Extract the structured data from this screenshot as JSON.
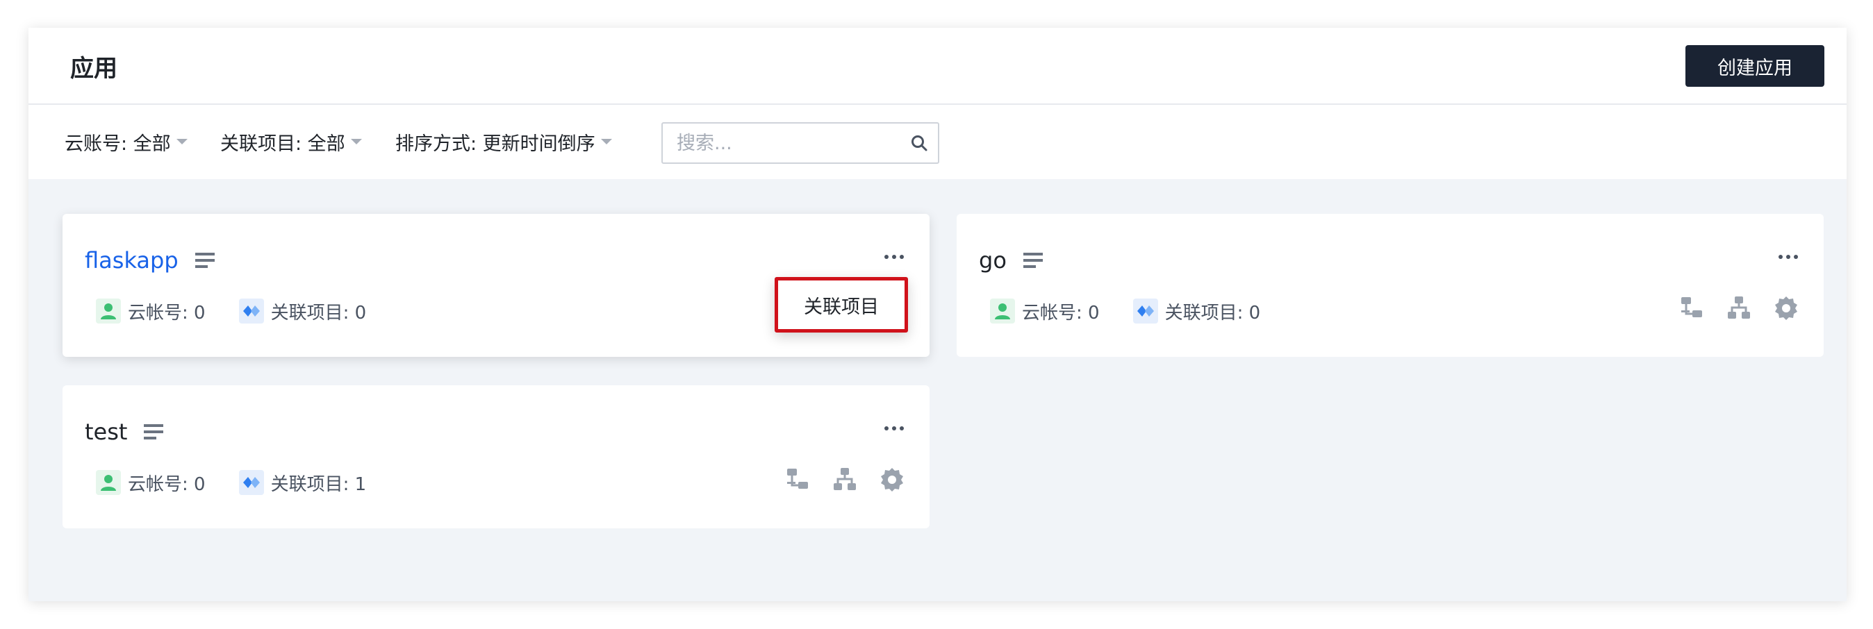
{
  "header": {
    "title": "应用",
    "create_label": "创建应用"
  },
  "filters": {
    "cloud_account": "云账号: 全部",
    "project": "关联项目: 全部",
    "sort": "排序方式: 更新时间倒序"
  },
  "search": {
    "placeholder": "搜索..."
  },
  "apps": [
    {
      "name": "flaskapp",
      "cloud_account": "云帐号: 0",
      "project": "关联项目: 0"
    },
    {
      "name": "go",
      "cloud_account": "云帐号: 0",
      "project": "关联项目: 0"
    },
    {
      "name": "test",
      "cloud_account": "云帐号: 0",
      "project": "关联项目: 1"
    }
  ],
  "dropdown": {
    "item": "关联项目"
  },
  "colors": {
    "link": "#1862e8",
    "dark_button": "#1a2333",
    "highlight_border": "#d0121b",
    "account_green": "#3cbf73",
    "project_blue": "#2f7ff0"
  }
}
